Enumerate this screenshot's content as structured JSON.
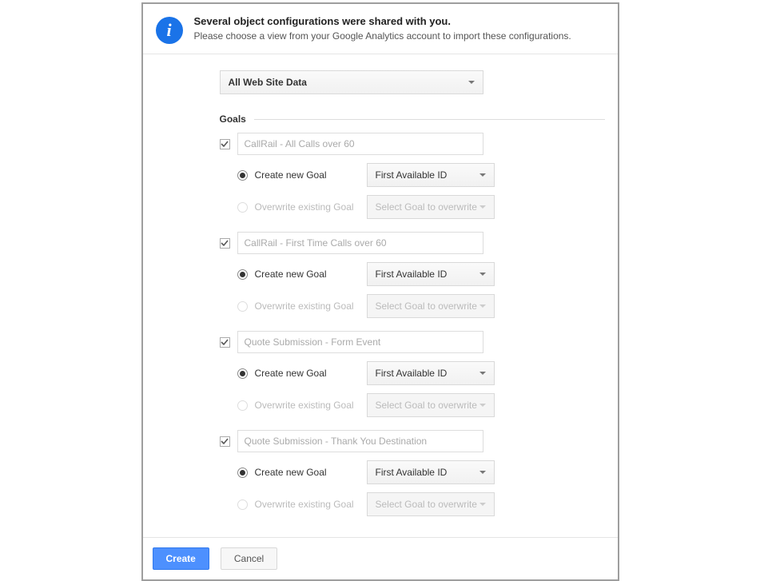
{
  "header": {
    "title": "Several object configurations were shared with you.",
    "subtitle": "Please choose a view from your Google Analytics account to import these configurations."
  },
  "view_selector": {
    "selected": "All Web Site Data"
  },
  "section_label": "Goals",
  "radio_labels": {
    "create": "Create new Goal",
    "overwrite": "Overwrite existing Goal"
  },
  "id_select": {
    "active": "First Available ID",
    "disabled": "Select Goal to overwrite"
  },
  "goals": [
    {
      "name": "CallRail - All Calls over 60"
    },
    {
      "name": "CallRail - First Time Calls over 60"
    },
    {
      "name": "Quote Submission - Form Event"
    },
    {
      "name": "Quote Submission - Thank You Destination"
    }
  ],
  "footer": {
    "create": "Create",
    "cancel": "Cancel"
  }
}
